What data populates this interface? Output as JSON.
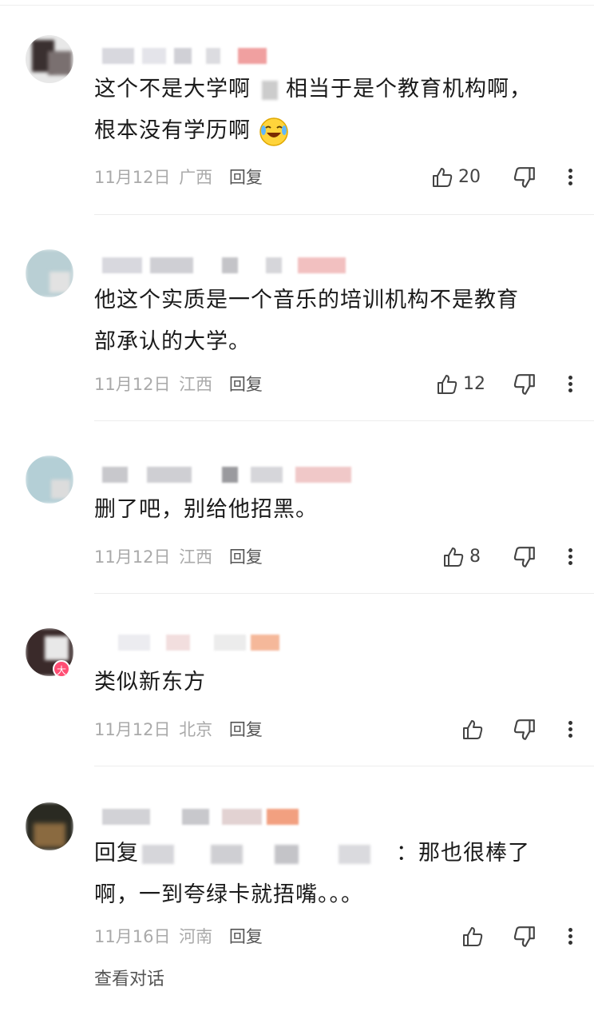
{
  "comments": [
    {
      "text_line1": "这个不是大学啊",
      "text_line1b": "相当于是个教育机构啊，",
      "text_line2": "根本没有学历啊",
      "date": "11月12日",
      "region": "广西",
      "reply": "回复",
      "likes": "20",
      "emoji": "laughing-crying"
    },
    {
      "text_line1": "他这个实质是一个音乐的培训机构不是教育",
      "text_line2": "部承认的大学。",
      "date": "11月12日",
      "region": "江西",
      "reply": "回复",
      "likes": "12"
    },
    {
      "text_line1": "删了吧，别给他招黑。",
      "date": "11月12日",
      "region": "江西",
      "reply": "回复",
      "likes": "8"
    },
    {
      "text_line1": "类似新东方",
      "date": "11月12日",
      "region": "北京",
      "reply": "回复",
      "likes": "",
      "badge": "大"
    },
    {
      "reply_prefix": "回复",
      "text_line1": "：那也很棒了",
      "text_line2": "啊，一到夸绿卡就捂嘴。。。",
      "date": "11月16日",
      "region": "河南",
      "reply": "回复",
      "likes": ""
    }
  ],
  "view_conversation": "查看对话",
  "colors": {
    "meta": "#aaaaaa",
    "text": "#1a1a1a",
    "badge": "#ff4d73"
  }
}
